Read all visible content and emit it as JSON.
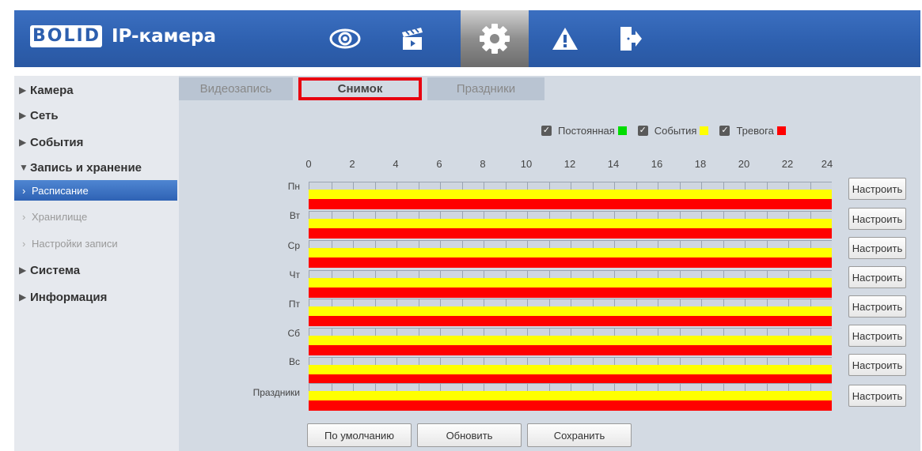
{
  "header": {
    "logo_letters": [
      "B",
      "O",
      "L",
      "I",
      "D"
    ],
    "title": "IP-камера",
    "nav": [
      {
        "name": "live-view-icon",
        "active": false
      },
      {
        "name": "playback-icon",
        "active": false
      },
      {
        "name": "settings-icon",
        "active": true
      },
      {
        "name": "alarm-icon",
        "active": false
      },
      {
        "name": "logout-icon",
        "active": false
      }
    ]
  },
  "sidebar": {
    "items": [
      {
        "label": "Камера",
        "expanded": false
      },
      {
        "label": "Сеть",
        "expanded": false
      },
      {
        "label": "События",
        "expanded": false
      },
      {
        "label": "Запись и хранение",
        "expanded": true
      },
      {
        "label": "Система",
        "expanded": false
      },
      {
        "label": "Информация",
        "expanded": false
      }
    ],
    "subitems": [
      {
        "label": "Расписание",
        "active": true
      },
      {
        "label": "Хранилище",
        "active": false
      },
      {
        "label": "Настройки записи",
        "active": false
      }
    ]
  },
  "tabs": [
    {
      "label": "Видеозапись",
      "selected": false
    },
    {
      "label": "Снимок",
      "selected": true
    },
    {
      "label": "Праздники",
      "selected": false
    }
  ],
  "legend": [
    {
      "label": "Постоянная",
      "checked": true,
      "color": "#00dd00"
    },
    {
      "label": "События",
      "checked": true,
      "color": "#ffff00"
    },
    {
      "label": "Тревога",
      "checked": true,
      "color": "#ff0000"
    }
  ],
  "hours": [
    "0",
    "2",
    "4",
    "6",
    "8",
    "10",
    "12",
    "14",
    "16",
    "18",
    "20",
    "22",
    "24"
  ],
  "days": [
    "Пн",
    "Вт",
    "Ср",
    "Чт",
    "Пт",
    "Сб",
    "Вс",
    "Праздники"
  ],
  "configure_label": "Настроить",
  "footer": {
    "default_label": "По умолчанию",
    "refresh_label": "Обновить",
    "save_label": "Сохранить"
  },
  "colors": {
    "accent": "#2d5fae",
    "highlight": "#e8000f",
    "event": "#ffff00",
    "alarm": "#ff0000"
  }
}
